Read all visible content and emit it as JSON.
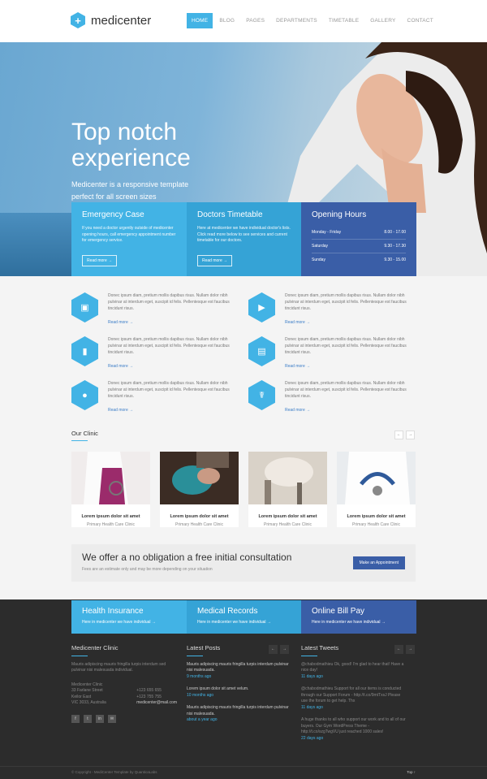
{
  "logo": {
    "text": "medicenter",
    "icon": "plus"
  },
  "nav": [
    "HOME",
    "BLOG",
    "PAGES",
    "DEPARTMENTS",
    "TIMETABLE",
    "GALLERY",
    "CONTACT"
  ],
  "hero": {
    "title": "Top notch experience",
    "subtitle": "Medicenter is a responsive template perfect for all screen sizes",
    "slide_1": "1",
    "slide_2": "2"
  },
  "boxes": {
    "emergency": {
      "title": "Emergency Case",
      "text": "If you need a doctor urgently outside of medicenter opening hours, call emergency appointment number for emergency service.",
      "button": "Read more →"
    },
    "timetable": {
      "title": "Doctors Timetable",
      "text": "Here at medicenter we have individual doctor's lists. Click read more below to see services and current timetable for our doctors.",
      "button": "Read more →"
    },
    "hours": {
      "title": "Opening Hours",
      "rows": [
        {
          "day": "Monday - Friday",
          "time": "8.00 - 17.00"
        },
        {
          "day": "Saturday",
          "time": "9.30 - 17.30"
        },
        {
          "day": "Sunday",
          "time": "9.30 - 15.00"
        }
      ]
    }
  },
  "features": [
    {
      "icon": "image-icon",
      "glyph": "▣",
      "text": "Donec ipsum diam, pretium mollis dapibus risus. Nullam dolor nibh pulvinar at interdum eget, suscipit id felis. Pellentesque est faucibus tincidunt risus.",
      "more": "Read more →"
    },
    {
      "icon": "video-icon",
      "glyph": "▶",
      "text": "Donec ipsum diam, pretium mollis dapibus risus. Nullam dolor nibh pulvinar at interdum eget, suscipit id felis. Pellentesque est faucibus tincidunt risus.",
      "more": "Read more →"
    },
    {
      "icon": "chart-icon",
      "glyph": "▮",
      "text": "Donec ipsum diam, pretium mollis dapibus risus. Nullam dolor nibh pulvinar at interdum eget, suscipit id felis. Pellentesque est faucibus tincidunt risus.",
      "more": "Read more →"
    },
    {
      "icon": "comment-icon",
      "glyph": "▤",
      "text": "Donec ipsum diam, pretium mollis dapibus risus. Nullam dolor nibh pulvinar at interdum eget, suscipit id felis. Pellentesque est faucibus tincidunt risus.",
      "more": "Read more →"
    },
    {
      "icon": "users-icon",
      "glyph": "●",
      "text": "Donec ipsum diam, pretium mollis dapibus risus. Nullam dolor nibh pulvinar at interdum eget, suscipit id felis. Pellentesque est faucibus tincidunt risus.",
      "more": "Read more →"
    },
    {
      "icon": "caduceus-icon",
      "glyph": "☤",
      "text": "Donec ipsum diam, pretium mollis dapibus risus. Nullam dolor nibh pulvinar at interdum eget, suscipit id felis. Pellentesque est faucibus tincidunt risus.",
      "more": "Read more →"
    }
  ],
  "clinic": {
    "title": "Our Clinic",
    "prev": "←",
    "next": "→",
    "cards": [
      {
        "title": "Lorem ipsum dolor sit amet",
        "sub": "Primary Health Care Clinic"
      },
      {
        "title": "Lorem ipsum dolor sit amet",
        "sub": "Primary Health Care Clinic"
      },
      {
        "title": "Lorem ipsum dolor sit amet",
        "sub": "Primary Health Care Clinic"
      },
      {
        "title": "Lorem ipsum dolor sit amet",
        "sub": "Primary Health Care Clinic"
      }
    ]
  },
  "consult": {
    "title": "We offer a no obligation a free initial consultation",
    "sub": "Fees are an estimate only and may be more depending on your situation",
    "button": "Make an Appointment"
  },
  "footer_boxes": [
    {
      "title": "Health Insurance",
      "text": "Here in medicenter we have individual →"
    },
    {
      "title": "Medical Records",
      "text": "Here in medicenter we have individual →"
    },
    {
      "title": "Online Bill Pay",
      "text": "Here in medicenter we have individual →"
    }
  ],
  "footer": {
    "about": {
      "title": "Medicenter Clinic",
      "text": "Mauris adipiscing mauris fringilla turpis interdum sed pulvinar nisi malesuada individual.",
      "name": "Medicenter Clinic",
      "street": "33 Farlane Street",
      "city": "Keilor East",
      "state": "VIC 3033, Australia",
      "phone1": "+123 655 655",
      "phone2": "+123 755 755",
      "email": "medicenter@mail.com",
      "social": [
        "f",
        "t",
        "in",
        "✉"
      ]
    },
    "posts": {
      "title": "Latest Posts",
      "items": [
        {
          "text": "Mauris adipiscing mauris fringilla turpis interdum pulvinar nisi malesuada.",
          "date": "9 months ago"
        },
        {
          "text": "Lorem ipsum dolor sit amet velum.",
          "date": "10 months ago"
        },
        {
          "text": "Mauris adipiscing mauris fringilla turpis interdum pulvinar nisi malesuada.",
          "date": "about a year ago"
        }
      ]
    },
    "tweets": {
      "title": "Latest Tweets",
      "items": [
        {
          "text": "@chabodmathieu Ok, good! I'm glad to hear that! Have a nice day!",
          "date": "11 days ago"
        },
        {
          "text": "@chabodmathieu Support for all our items is conducted through our Support Forum - http://t.co/9mtTxsJ Please use the forum to get help. Thx",
          "date": "11 days ago"
        },
        {
          "text": "A huge thanks to all who support our work and to all of our buyers. Our Gym WordPress Theme - http://t.co/szgTwgVU just reached 1000 sales!",
          "date": "22 days ago"
        }
      ]
    },
    "arrow_left": "←",
    "arrow_right": "→",
    "copyright": "© Copyright - MediCenter Template by QuanticaLabs",
    "top": "Top ↑"
  },
  "colors": {
    "accent": "#42b3e5",
    "dark_blue": "#3a5ea7",
    "footer": "#2c2c2c"
  }
}
